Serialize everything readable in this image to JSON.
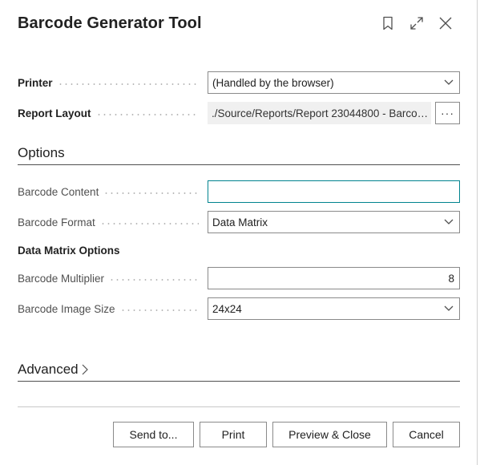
{
  "dialog": {
    "title": "Barcode Generator Tool"
  },
  "fields": {
    "printer": {
      "label": "Printer",
      "value": "(Handled by the browser)"
    },
    "report_layout": {
      "label": "Report Layout",
      "value": "./Source/Reports/Report 23044800 - Barcode Generator Tool.rdlc",
      "assist": "···"
    }
  },
  "options": {
    "title": "Options",
    "barcode_content": {
      "label": "Barcode Content",
      "value": ""
    },
    "barcode_format": {
      "label": "Barcode Format",
      "value": "Data Matrix"
    },
    "data_matrix_heading": "Data Matrix Options",
    "barcode_multiplier": {
      "label": "Barcode Multiplier",
      "value": "8"
    },
    "barcode_image_size": {
      "label": "Barcode Image Size",
      "value": "24x24"
    }
  },
  "advanced": {
    "title": "Advanced"
  },
  "buttons": {
    "send_to": "Send to...",
    "print": "Print",
    "preview_close": "Preview & Close",
    "cancel": "Cancel"
  },
  "icons": [
    "bookmark-icon",
    "expand-icon",
    "close-icon",
    "chevron-down-icon",
    "chevron-right-icon"
  ],
  "colors": {
    "focus_border": "#00838f",
    "text": "#212121",
    "label": "#505050"
  }
}
